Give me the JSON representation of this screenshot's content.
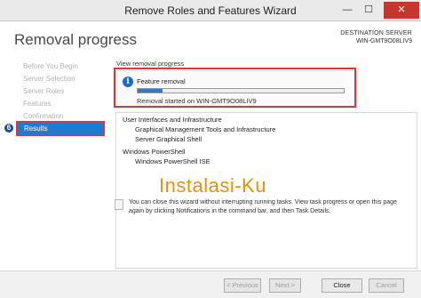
{
  "window": {
    "title": "Remove Roles and Features Wizard",
    "minimize_glyph": "—",
    "maximize_glyph": "☐",
    "close_glyph": "✕"
  },
  "header": {
    "page_title": "Removal progress",
    "destination_caption": "DESTINATION SERVER",
    "destination_server": "WIN-GMT9O08LIV9"
  },
  "nav": {
    "items": [
      {
        "label": "Before You Begin",
        "state": "disabled"
      },
      {
        "label": "Server Selection",
        "state": "disabled"
      },
      {
        "label": "Server Roles",
        "state": "disabled"
      },
      {
        "label": "Features",
        "state": "disabled"
      },
      {
        "label": "Confirmation",
        "state": "disabled"
      },
      {
        "label": "Results",
        "state": "active"
      }
    ],
    "step_badge": "6"
  },
  "progress": {
    "view_label": "View removal progress",
    "info_icon_glyph": "i",
    "feature_label": "Feature removal",
    "percent": 12,
    "status": "Removal started on WIN-GMT9O08LIV9"
  },
  "details": {
    "lines": [
      {
        "text": "User Interfaces and Infrastructure",
        "level": 1
      },
      {
        "text": "Graphical Management Tools and Infrastructure",
        "level": 2
      },
      {
        "text": "Server Graphical Shell",
        "level": 2
      },
      {
        "text": "Windows PowerShell",
        "level": 1
      },
      {
        "text": "Windows PowerShell ISE",
        "level": 2
      }
    ]
  },
  "watermark": "Instalasi-Ku",
  "note": "You can close this wizard without interrupting running tasks. View task progress or open this page again by clicking Notifications in the command bar, and then Task Details.",
  "buttons": {
    "previous": "< Previous",
    "next": "Next >",
    "close": "Close",
    "cancel": "Cancel"
  },
  "colors": {
    "accent": "#1e7bd2",
    "highlight_border": "#d53a3a",
    "progress_fill": "#3b78c4",
    "watermark": "#e8900a"
  }
}
